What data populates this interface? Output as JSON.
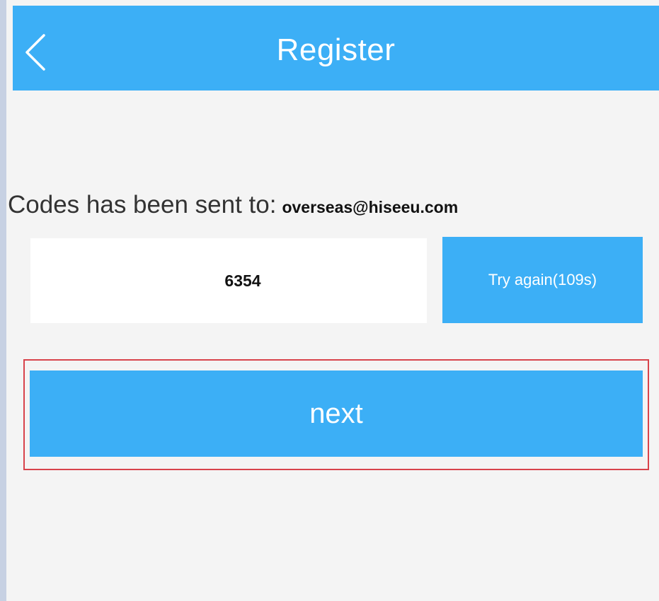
{
  "header": {
    "title": "Register",
    "back_icon": "chevron-left-icon"
  },
  "verification": {
    "sent_label": "Codes has been sent to:",
    "email": "overseas@hiseeu.com",
    "code_value": "6354",
    "retry_label": "Try again(109s)"
  },
  "actions": {
    "next_label": "next"
  },
  "colors": {
    "accent": "#3caff6",
    "background": "#f4f4f4",
    "highlight": "#d8434b"
  }
}
